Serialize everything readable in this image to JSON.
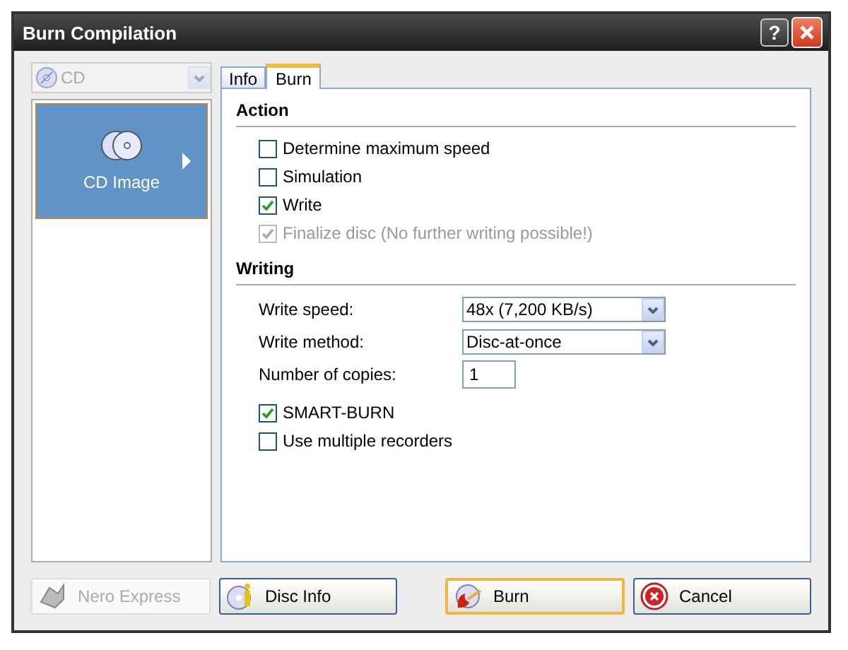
{
  "window": {
    "title": "Burn Compilation",
    "help": "?"
  },
  "recorder": {
    "value": "CD",
    "disabled": true
  },
  "sidebar": {
    "items": [
      {
        "label": "CD Image",
        "selected": true
      }
    ]
  },
  "tabs": [
    {
      "label": "Info",
      "selected": false
    },
    {
      "label": "Burn",
      "selected": true
    }
  ],
  "sections": [
    {
      "title": "Action",
      "rows": [
        {
          "kind": "checkbox",
          "label": "Determine maximum speed",
          "checked": false,
          "disabled": false
        },
        {
          "kind": "checkbox",
          "label": "Simulation",
          "checked": false,
          "disabled": false
        },
        {
          "kind": "checkbox",
          "label": "Write",
          "checked": true,
          "disabled": false
        },
        {
          "kind": "checkbox",
          "label": "Finalize disc (No further writing possible!)",
          "checked": true,
          "disabled": true
        }
      ]
    },
    {
      "title": "Writing",
      "rows": [
        {
          "kind": "select",
          "label": "Write speed:",
          "value": "48x (7,200 KB/s)"
        },
        {
          "kind": "select",
          "label": "Write method:",
          "value": "Disc-at-once"
        },
        {
          "kind": "number",
          "label": "Number of copies:",
          "value": "1"
        },
        {
          "kind": "checkbox",
          "label": "SMART-BURN",
          "checked": true,
          "disabled": false
        },
        {
          "kind": "checkbox",
          "label": "Use multiple recorders",
          "checked": false,
          "disabled": false
        }
      ]
    }
  ],
  "buttons": [
    {
      "kind": "nero",
      "label": "Nero Express",
      "disabled": true,
      "default": false
    },
    {
      "kind": "info",
      "label": "Disc Info",
      "disabled": false,
      "default": false
    },
    {
      "kind": "burn",
      "label": "Burn",
      "disabled": false,
      "default": true
    },
    {
      "kind": "cancel",
      "label": "Cancel",
      "disabled": false,
      "default": false
    }
  ]
}
